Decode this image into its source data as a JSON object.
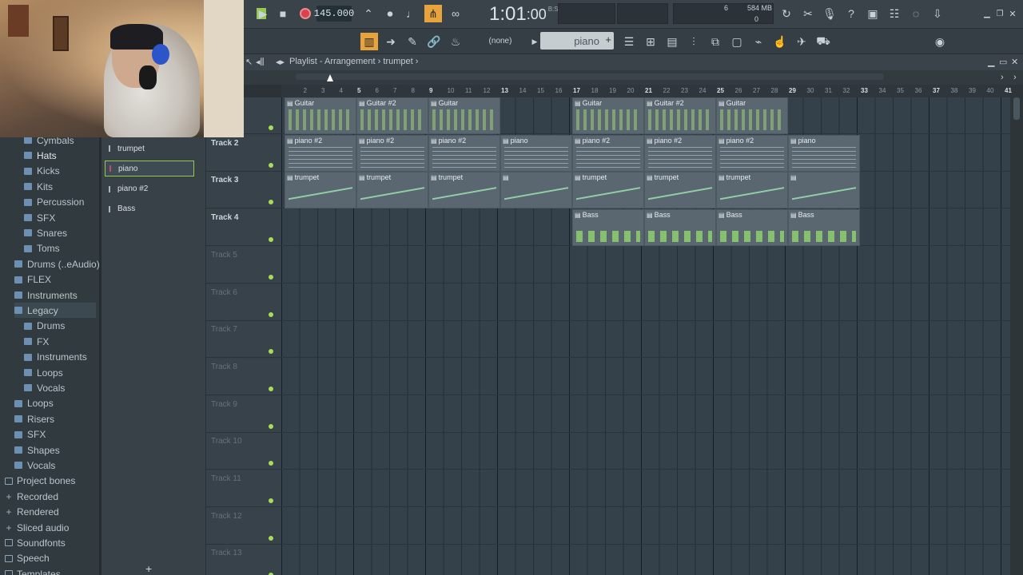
{
  "transport": {
    "tempo": "145.000",
    "time": "1:01",
    "time_frac": ":00",
    "time_sub": "B:S:T",
    "cpu": "6",
    "memory": "584 MB",
    "memory_zero": "0",
    "snap": "(none)",
    "pattern": "piano",
    "pattern_add": "+"
  },
  "playlist": {
    "title": "Playlist - Arrangement",
    "breadcrumb_sep": "›",
    "current": "trumpet"
  },
  "browser": {
    "items": [
      {
        "label": "Cymbals",
        "kind": "folder",
        "indent": 2
      },
      {
        "label": "Hats",
        "kind": "folder",
        "indent": 2,
        "selected": true
      },
      {
        "label": "Kicks",
        "kind": "folder",
        "indent": 2
      },
      {
        "label": "Kits",
        "kind": "folder",
        "indent": 2
      },
      {
        "label": "Percussion",
        "kind": "folder",
        "indent": 2
      },
      {
        "label": "SFX",
        "kind": "folder",
        "indent": 2
      },
      {
        "label": "Snares",
        "kind": "folder",
        "indent": 2
      },
      {
        "label": "Toms",
        "kind": "folder",
        "indent": 2
      },
      {
        "label": "Drums (..eAudio)",
        "kind": "folder",
        "indent": 1
      },
      {
        "label": "FLEX",
        "kind": "folder",
        "indent": 1
      },
      {
        "label": "Instruments",
        "kind": "folder",
        "indent": 1
      },
      {
        "label": "Legacy",
        "kind": "folder",
        "indent": 1,
        "highlight": true
      },
      {
        "label": "Drums",
        "kind": "folder",
        "indent": 2
      },
      {
        "label": "FX",
        "kind": "folder",
        "indent": 2
      },
      {
        "label": "Instruments",
        "kind": "folder",
        "indent": 2
      },
      {
        "label": "Loops",
        "kind": "folder",
        "indent": 2
      },
      {
        "label": "Vocals",
        "kind": "folder",
        "indent": 2
      },
      {
        "label": "Loops",
        "kind": "folder",
        "indent": 1
      },
      {
        "label": "Risers",
        "kind": "folder",
        "indent": 1
      },
      {
        "label": "SFX",
        "kind": "folder",
        "indent": 1
      },
      {
        "label": "Shapes",
        "kind": "folder",
        "indent": 1
      },
      {
        "label": "Vocals",
        "kind": "folder",
        "indent": 1
      },
      {
        "label": "Project bones",
        "kind": "open",
        "indent": 0
      },
      {
        "label": "Recorded",
        "kind": "plus",
        "indent": 0
      },
      {
        "label": "Rendered",
        "kind": "plus",
        "indent": 0
      },
      {
        "label": "Sliced audio",
        "kind": "plus",
        "indent": 0
      },
      {
        "label": "Soundfonts",
        "kind": "open",
        "indent": 0
      },
      {
        "label": "Speech",
        "kind": "open",
        "indent": 0
      },
      {
        "label": "Templates",
        "kind": "open",
        "indent": 0
      }
    ]
  },
  "picker": {
    "items": [
      {
        "label": "trumpet"
      },
      {
        "label": "piano",
        "selected": true
      },
      {
        "label": "piano #2"
      },
      {
        "label": "Bass"
      }
    ],
    "add": "+"
  },
  "ruler": [
    "2",
    "3",
    "4",
    "5",
    "6",
    "7",
    "8",
    "9",
    "10",
    "11",
    "12",
    "13",
    "14",
    "15",
    "16",
    "17",
    "18",
    "19",
    "20",
    "21",
    "22",
    "23",
    "24",
    "25",
    "26",
    "27",
    "28",
    "29",
    "30",
    "31",
    "32",
    "33",
    "34",
    "35",
    "36",
    "37",
    "38",
    "39",
    "40",
    "41"
  ],
  "tracks": [
    {
      "name": "",
      "empty": false
    },
    {
      "name": "Track 2",
      "empty": false
    },
    {
      "name": "Track 3",
      "empty": false
    },
    {
      "name": "Track 4",
      "empty": false
    },
    {
      "name": "Track 5",
      "empty": true
    },
    {
      "name": "Track 6",
      "empty": true
    },
    {
      "name": "Track 7",
      "empty": true
    },
    {
      "name": "Track 8",
      "empty": true
    },
    {
      "name": "Track 9",
      "empty": true
    },
    {
      "name": "Track 10",
      "empty": true
    },
    {
      "name": "Track 11",
      "empty": true
    },
    {
      "name": "Track 12",
      "empty": true
    },
    {
      "name": "Track 13",
      "empty": true
    }
  ],
  "clips": [
    {
      "track": 0,
      "bar": 1,
      "len": 4,
      "label": "Guitar",
      "type": "guitar"
    },
    {
      "track": 0,
      "bar": 5,
      "len": 4,
      "label": "Guitar #2",
      "type": "guitar"
    },
    {
      "track": 0,
      "bar": 9,
      "len": 4,
      "label": "Guitar",
      "type": "guitar"
    },
    {
      "track": 0,
      "bar": 17,
      "len": 4,
      "label": "Guitar",
      "type": "guitar"
    },
    {
      "track": 0,
      "bar": 21,
      "len": 4,
      "label": "Guitar #2",
      "type": "guitar"
    },
    {
      "track": 0,
      "bar": 25,
      "len": 4,
      "label": "Guitar",
      "type": "guitar"
    },
    {
      "track": 1,
      "bar": 1,
      "len": 4,
      "label": "piano #2",
      "type": "piano"
    },
    {
      "track": 1,
      "bar": 5,
      "len": 4,
      "label": "piano #2",
      "type": "piano"
    },
    {
      "track": 1,
      "bar": 9,
      "len": 4,
      "label": "piano #2",
      "type": "piano"
    },
    {
      "track": 1,
      "bar": 13,
      "len": 4,
      "label": "piano",
      "type": "piano"
    },
    {
      "track": 1,
      "bar": 17,
      "len": 4,
      "label": "piano #2",
      "type": "piano"
    },
    {
      "track": 1,
      "bar": 21,
      "len": 4,
      "label": "piano #2",
      "type": "piano"
    },
    {
      "track": 1,
      "bar": 25,
      "len": 4,
      "label": "piano #2",
      "type": "piano"
    },
    {
      "track": 1,
      "bar": 29,
      "len": 4,
      "label": "piano",
      "type": "piano"
    },
    {
      "track": 2,
      "bar": 1,
      "len": 4,
      "label": "trumpet",
      "type": "trumpet"
    },
    {
      "track": 2,
      "bar": 5,
      "len": 4,
      "label": "trumpet",
      "type": "trumpet"
    },
    {
      "track": 2,
      "bar": 9,
      "len": 4,
      "label": "trumpet",
      "type": "trumpet"
    },
    {
      "track": 2,
      "bar": 13,
      "len": 4,
      "label": "",
      "type": "trumpet"
    },
    {
      "track": 2,
      "bar": 17,
      "len": 4,
      "label": "trumpet",
      "type": "trumpet"
    },
    {
      "track": 2,
      "bar": 21,
      "len": 4,
      "label": "trumpet",
      "type": "trumpet"
    },
    {
      "track": 2,
      "bar": 25,
      "len": 4,
      "label": "trumpet",
      "type": "trumpet"
    },
    {
      "track": 2,
      "bar": 29,
      "len": 4,
      "label": "",
      "type": "trumpet"
    },
    {
      "track": 3,
      "bar": 17,
      "len": 4,
      "label": "Bass",
      "type": "bass"
    },
    {
      "track": 3,
      "bar": 21,
      "len": 4,
      "label": "Bass",
      "type": "bass"
    },
    {
      "track": 3,
      "bar": 25,
      "len": 4,
      "label": "Bass",
      "type": "bass"
    },
    {
      "track": 3,
      "bar": 29,
      "len": 4,
      "label": "Bass",
      "type": "bass"
    }
  ],
  "colors": {
    "accent": "#96c94e",
    "record": "#d9434b",
    "active": "#e8a33c"
  }
}
